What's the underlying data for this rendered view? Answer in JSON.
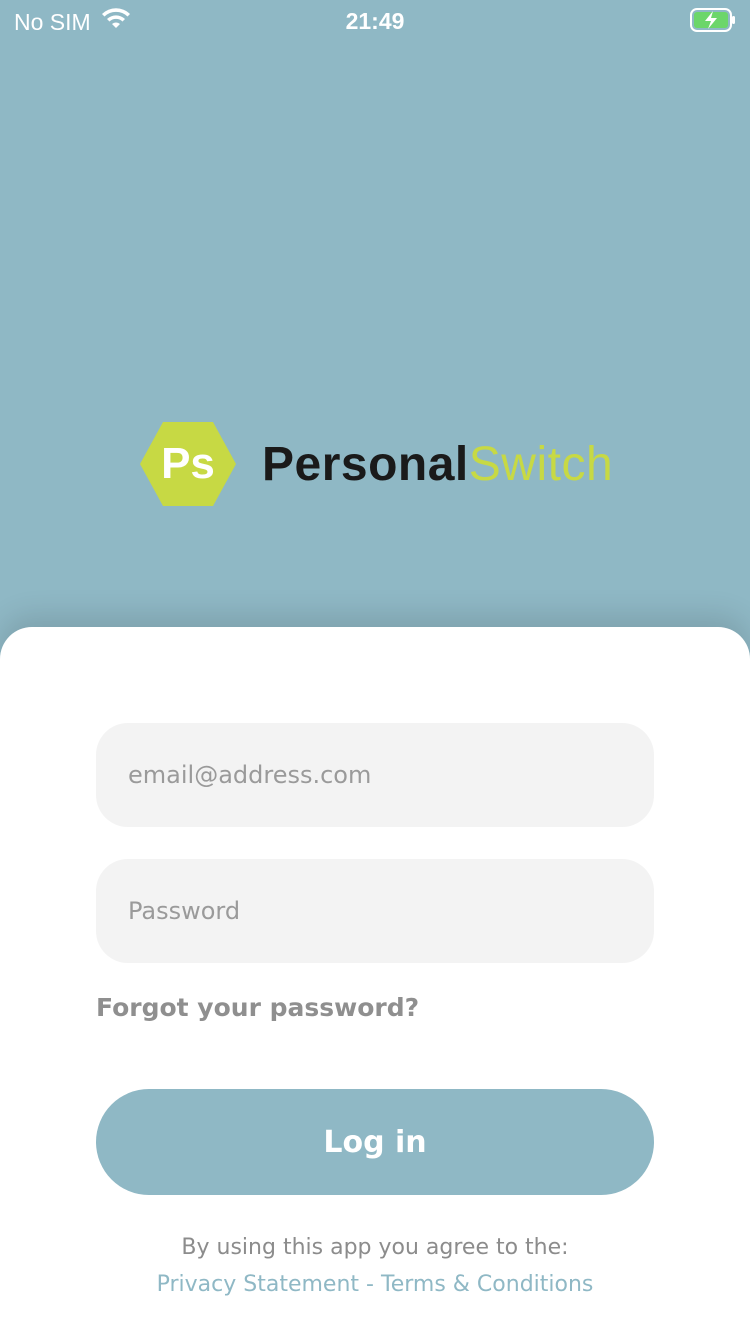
{
  "status_bar": {
    "carrier": "No SIM",
    "time": "21:49",
    "icons": [
      "wifi-icon",
      "battery-charging-icon"
    ]
  },
  "logo": {
    "mark": "Ps",
    "word_dark": "Personal",
    "word_accent": "Switch",
    "colors": {
      "hex": "#c7d944",
      "dark_text": "#1a1a1a",
      "accent_text": "#c7d944"
    }
  },
  "login": {
    "email_placeholder": "email@address.com",
    "password_placeholder": "Password",
    "forgot_label": "Forgot your password?",
    "login_label": "Log in"
  },
  "footer": {
    "agree_text": "By using this app you agree to the:",
    "privacy_label": "Privacy Statement",
    "separator": "-",
    "terms_label": "Terms & Conditions"
  },
  "colors": {
    "background": "#8fb8c5",
    "sheet": "#ffffff",
    "field_bg": "#f3f3f3",
    "button": "#8fb8c5",
    "link": "#8fb8c5"
  }
}
